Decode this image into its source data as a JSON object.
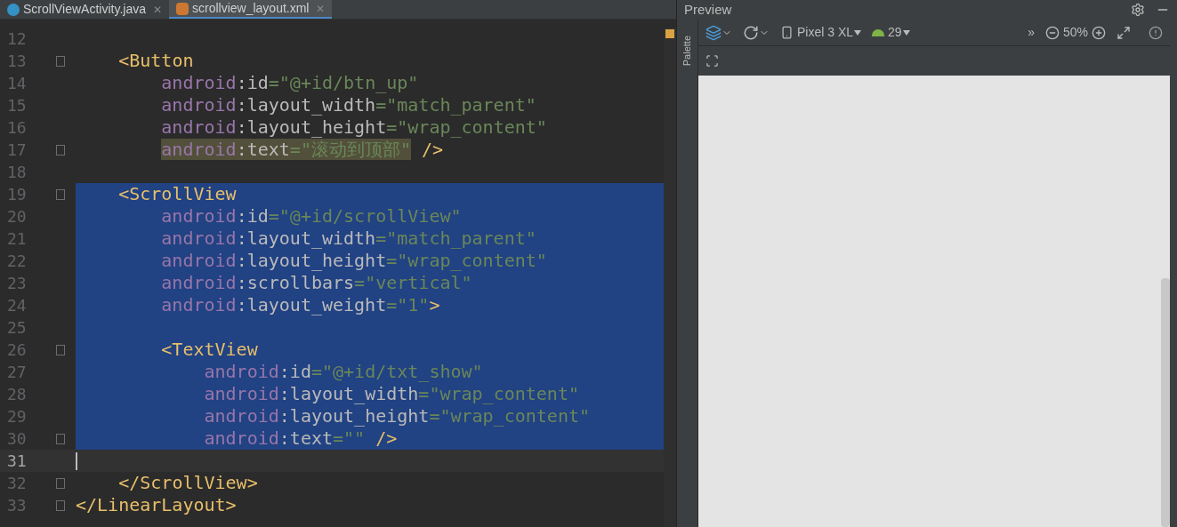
{
  "tabs": [
    {
      "label": "ScrollViewActivity.java",
      "close": "✕",
      "selected": false
    },
    {
      "label": "scrollview_layout.xml",
      "close": "✕",
      "selected": true
    }
  ],
  "editor": {
    "lines": [
      {
        "n": "12",
        "fold": false,
        "selected": false,
        "current": false
      },
      {
        "n": "13",
        "fold": true,
        "selected": false,
        "current": false,
        "tokens": [
          {
            "kind": "tag",
            "text": "    <Button"
          }
        ]
      },
      {
        "n": "14",
        "fold": false,
        "selected": false,
        "current": false,
        "tokens": [
          {
            "kind": "ns",
            "text": "        android"
          },
          {
            "kind": "punct",
            "text": ":"
          },
          {
            "kind": "attr",
            "text": "id"
          },
          {
            "kind": "value",
            "text": "=\"@+id/btn_up\""
          }
        ]
      },
      {
        "n": "15",
        "fold": false,
        "selected": false,
        "current": false,
        "tokens": [
          {
            "kind": "ns",
            "text": "        android"
          },
          {
            "kind": "punct",
            "text": ":"
          },
          {
            "kind": "attr",
            "text": "layout_width"
          },
          {
            "kind": "value",
            "text": "=\"match_parent\""
          }
        ]
      },
      {
        "n": "16",
        "fold": false,
        "selected": false,
        "current": false,
        "tokens": [
          {
            "kind": "ns",
            "text": "        android"
          },
          {
            "kind": "punct",
            "text": ":"
          },
          {
            "kind": "attr",
            "text": "layout_height"
          },
          {
            "kind": "value",
            "text": "=\"wrap_content\""
          }
        ]
      },
      {
        "n": "17",
        "fold": true,
        "selected": false,
        "current": false,
        "tokens": [
          {
            "kind": "ns",
            "text": "        android",
            "warn": true
          },
          {
            "kind": "punct",
            "text": ":",
            "warn": true
          },
          {
            "kind": "attr",
            "text": "text",
            "warn": true
          },
          {
            "kind": "value",
            "text": "=\"滚动到顶部\"",
            "warn": true
          },
          {
            "kind": "tag",
            "text": " />",
            "warn": false
          }
        ]
      },
      {
        "n": "18",
        "fold": false,
        "selected": false,
        "current": false
      },
      {
        "n": "19",
        "fold": true,
        "selected": true,
        "current": false,
        "tokens": [
          {
            "kind": "tag",
            "text": "    <ScrollView"
          }
        ]
      },
      {
        "n": "20",
        "fold": false,
        "selected": true,
        "current": false,
        "tokens": [
          {
            "kind": "ns",
            "text": "        android"
          },
          {
            "kind": "punct",
            "text": ":"
          },
          {
            "kind": "attr",
            "text": "id"
          },
          {
            "kind": "value",
            "text": "=\"@+id/scrollView\""
          }
        ]
      },
      {
        "n": "21",
        "fold": false,
        "selected": true,
        "current": false,
        "tokens": [
          {
            "kind": "ns",
            "text": "        android"
          },
          {
            "kind": "punct",
            "text": ":"
          },
          {
            "kind": "attr",
            "text": "layout_width"
          },
          {
            "kind": "value",
            "text": "=\"match_parent\""
          }
        ]
      },
      {
        "n": "22",
        "fold": false,
        "selected": true,
        "current": false,
        "tokens": [
          {
            "kind": "ns",
            "text": "        android"
          },
          {
            "kind": "punct",
            "text": ":"
          },
          {
            "kind": "attr",
            "text": "layout_height"
          },
          {
            "kind": "value",
            "text": "=\"wrap_content\""
          }
        ]
      },
      {
        "n": "23",
        "fold": false,
        "selected": true,
        "current": false,
        "tokens": [
          {
            "kind": "ns",
            "text": "        android"
          },
          {
            "kind": "punct",
            "text": ":"
          },
          {
            "kind": "attr",
            "text": "scrollbars"
          },
          {
            "kind": "value",
            "text": "=\"vertical\""
          }
        ]
      },
      {
        "n": "24",
        "fold": false,
        "selected": true,
        "current": false,
        "tokens": [
          {
            "kind": "ns",
            "text": "        android"
          },
          {
            "kind": "punct",
            "text": ":"
          },
          {
            "kind": "attr",
            "text": "layout_weight"
          },
          {
            "kind": "value",
            "text": "=\"1\""
          },
          {
            "kind": "tag",
            "text": ">"
          }
        ]
      },
      {
        "n": "25",
        "fold": false,
        "selected": true,
        "current": false
      },
      {
        "n": "26",
        "fold": true,
        "selected": true,
        "current": false,
        "tokens": [
          {
            "kind": "tag",
            "text": "        <TextView"
          }
        ]
      },
      {
        "n": "27",
        "fold": false,
        "selected": true,
        "current": false,
        "tokens": [
          {
            "kind": "ns",
            "text": "            android"
          },
          {
            "kind": "punct",
            "text": ":"
          },
          {
            "kind": "attr",
            "text": "id"
          },
          {
            "kind": "value",
            "text": "=\"@+id/txt_show\""
          }
        ]
      },
      {
        "n": "28",
        "fold": false,
        "selected": true,
        "current": false,
        "tokens": [
          {
            "kind": "ns",
            "text": "            android"
          },
          {
            "kind": "punct",
            "text": ":"
          },
          {
            "kind": "attr",
            "text": "layout_width"
          },
          {
            "kind": "value",
            "text": "=\"wrap_content\""
          }
        ]
      },
      {
        "n": "29",
        "fold": false,
        "selected": true,
        "current": false,
        "tokens": [
          {
            "kind": "ns",
            "text": "            android"
          },
          {
            "kind": "punct",
            "text": ":"
          },
          {
            "kind": "attr",
            "text": "layout_height"
          },
          {
            "kind": "value",
            "text": "=\"wrap_content\""
          }
        ]
      },
      {
        "n": "30",
        "fold": true,
        "selected": true,
        "current": false,
        "tokens": [
          {
            "kind": "ns",
            "text": "            android"
          },
          {
            "kind": "punct",
            "text": ":"
          },
          {
            "kind": "attr",
            "text": "text"
          },
          {
            "kind": "value",
            "text": "=\"\""
          },
          {
            "kind": "tag",
            "text": " />"
          }
        ]
      },
      {
        "n": "31",
        "fold": false,
        "selected": false,
        "current": true
      },
      {
        "n": "32",
        "fold": true,
        "selected": false,
        "current": false,
        "tokens": [
          {
            "kind": "tag",
            "text": "    </ScrollView>"
          }
        ]
      },
      {
        "n": "33",
        "fold": true,
        "selected": false,
        "current": false,
        "tokens": [
          {
            "kind": "tag",
            "text": "</LinearLayout>"
          }
        ]
      }
    ]
  },
  "preview": {
    "title": "Preview",
    "palette_label": "Palette",
    "device": "Pixel 3 XL",
    "api": "29",
    "overflow": "»",
    "zoom": "50%"
  }
}
